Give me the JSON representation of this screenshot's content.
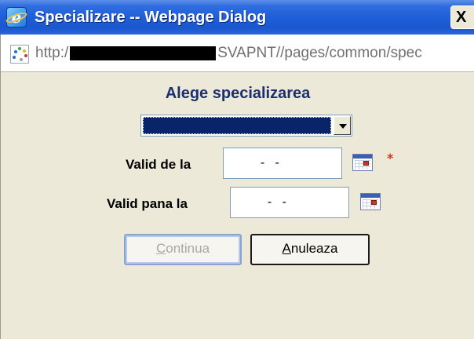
{
  "window": {
    "title": "Specializare -- Webpage Dialog",
    "close_label": "X"
  },
  "address": {
    "prefix": "http:/",
    "suffix": "SVAPNT//pages/common/spec"
  },
  "form": {
    "heading": "Alege specializarea",
    "specializare_selected": "",
    "valid_from_label": "Valid de la",
    "valid_from_value": "  -   -",
    "required_marker": "*",
    "valid_to_label": "Valid pana la",
    "valid_to_value": "  -   -"
  },
  "buttons": {
    "continue_mnemonic": "C",
    "continue_rest": "ontinua",
    "cancel_mnemonic": "A",
    "cancel_rest": "nuleaza"
  },
  "colors": {
    "title_bar": "#1f5fd8",
    "heading": "#1b2f6e",
    "required": "#e03020",
    "selection": "#0a246a"
  }
}
